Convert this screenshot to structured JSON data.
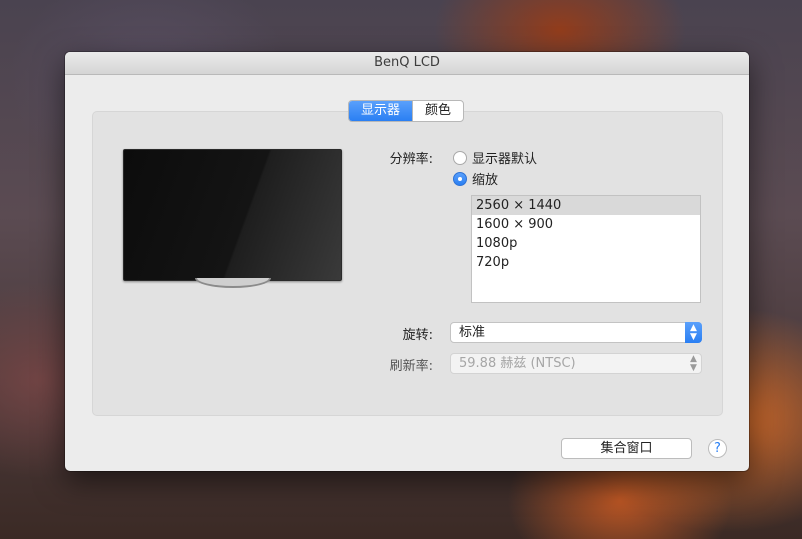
{
  "window": {
    "title": "BenQ LCD"
  },
  "tabs": [
    {
      "label": "显示器",
      "active": true
    },
    {
      "label": "颜色",
      "active": false
    }
  ],
  "resolution": {
    "label": "分辨率:",
    "options": [
      {
        "label": "显示器默认",
        "checked": false
      },
      {
        "label": "缩放",
        "checked": true
      }
    ],
    "list": [
      "2560 × 1440",
      "1600 × 900",
      "1080p",
      "720p"
    ],
    "selected": "2560 × 1440"
  },
  "rotation": {
    "label": "旋转:",
    "value": "标准"
  },
  "refresh": {
    "label": "刷新率:",
    "value": "59.88 赫兹 (NTSC)"
  },
  "buttons": {
    "gather_windows": "集合窗口",
    "help": "?"
  },
  "colors": {
    "accent": "#2a7ff3"
  }
}
